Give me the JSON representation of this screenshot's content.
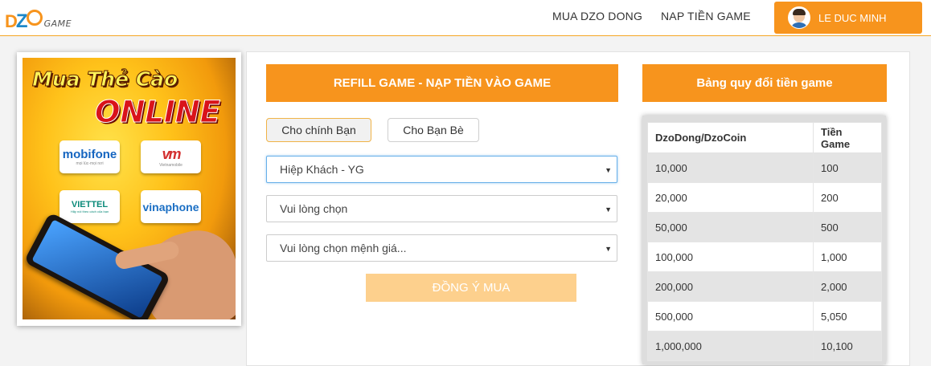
{
  "brand": {
    "logo_text": "DZOGAME"
  },
  "nav": {
    "buy_dzo_dong": "MUA DZO DONG",
    "topup_game": "NAP TIỀN GAME",
    "user_name": "LE DUC MINH"
  },
  "banner": {
    "headline_1": "Mua Thẻ Cào",
    "headline_2": "ONLINE",
    "carriers": [
      {
        "name": "mobifone",
        "tagline": "mọi lúc-mọi nơi"
      },
      {
        "name": "vm",
        "tagline": "Vietnamobile"
      },
      {
        "name": "VIETTEL",
        "tagline": "Hãy nói theo cách của bạn"
      },
      {
        "name": "vinaphone",
        "tagline": ""
      }
    ]
  },
  "form": {
    "title": "REFILL GAME - NẠP TIỀN VÀO GAME",
    "tabs": [
      "Cho chính Bạn",
      "Cho Bạn Bè"
    ],
    "active_tab": 0,
    "game_select": "Hiệp Khách - YG",
    "server_select": "Vui lòng chọn",
    "denomination_select": "Vui lòng chọn mệnh giá...",
    "submit_label": "ĐỒNG Ý MUA"
  },
  "rates": {
    "title": "Bảng quy đổi tiền game",
    "headers": [
      "DzoDong/DzoCoin",
      "Tiền Game"
    ],
    "rows": [
      [
        "10,000",
        "100"
      ],
      [
        "20,000",
        "200"
      ],
      [
        "50,000",
        "500"
      ],
      [
        "100,000",
        "1,000"
      ],
      [
        "200,000",
        "2,000"
      ],
      [
        "500,000",
        "5,050"
      ],
      [
        "1,000,000",
        "10,100"
      ]
    ]
  },
  "colors": {
    "accent": "#f7941d",
    "submit_disabled": "#fdd08d",
    "focus_border": "#66afe9"
  }
}
